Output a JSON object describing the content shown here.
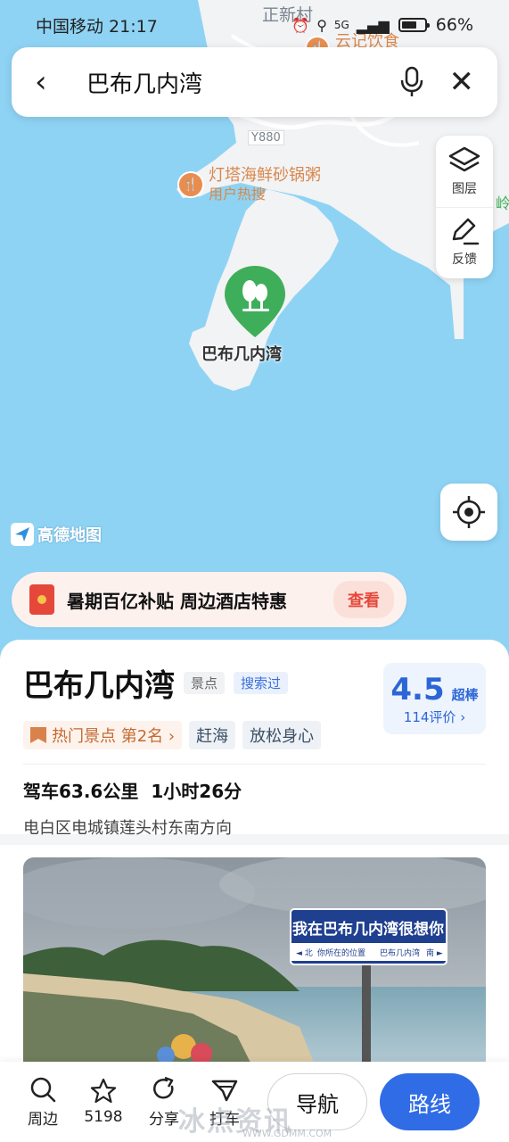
{
  "status_bar": {
    "carrier_time": "中国移动 21:17",
    "network": "5G",
    "battery_text": "66%",
    "battery_level": 0.66
  },
  "search": {
    "query": "巴布几内湾"
  },
  "map": {
    "labels": {
      "village": "正新村",
      "road": "Y880",
      "restaurant_top": "云记饮食",
      "right_edge": "岭"
    },
    "poi": {
      "name": "灯塔海鲜砂锅粥",
      "sub": "用户热搜"
    },
    "main_pin_label": "巴布几内湾",
    "logo_text": "高德地图",
    "tools": {
      "layers_label": "图层",
      "feedback_label": "反馈"
    }
  },
  "promo": {
    "text": "暑期百亿补贴 周边酒店特惠",
    "cta": "查看"
  },
  "place": {
    "name": "巴布几内湾",
    "type_tag": "景点",
    "searched_tag": "搜索过",
    "rank_tag": "热门景点 第2名 ›",
    "chips": [
      "赶海",
      "放松身心"
    ],
    "rating": {
      "score": "4.5",
      "word": "超棒",
      "count": "114评价 ›"
    },
    "drive_distance": "驾车63.6公里",
    "drive_time": "1小时26分",
    "address": "电白区电城镇莲头村东南方向"
  },
  "photo": {
    "sign_line1": "我在巴布几内湾很想你",
    "sign_line2_left": "◄ 北",
    "sign_line2_mid": "你所在的位置",
    "sign_line2_right": "巴布几内湾",
    "sign_line2_end": "南 ►"
  },
  "bottom_bar": {
    "nearby": "周边",
    "favorites_count": "5198",
    "share": "分享",
    "taxi": "打车",
    "navigate": "导航",
    "route": "路线"
  },
  "watermark": {
    "main": "冰点资讯",
    "sub": "WWW.GDMM.COM"
  },
  "colors": {
    "sea": "#8fd3f4",
    "land": "#f2f3f5",
    "accent_blue": "#2f6ce5",
    "pin_green": "#3fae5a",
    "promo_red": "#e5483a"
  }
}
